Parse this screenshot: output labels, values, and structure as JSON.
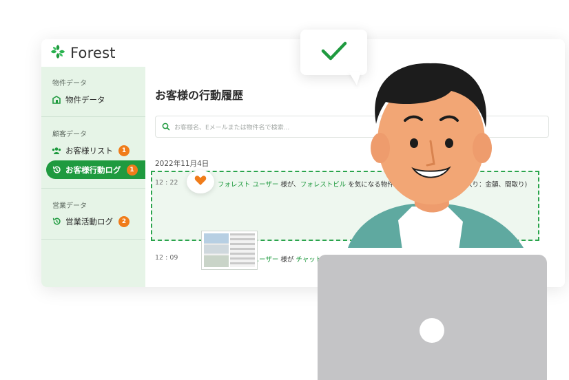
{
  "app": {
    "name": "Forest"
  },
  "sidebar": {
    "groups": [
      {
        "title": "物件データ",
        "items": [
          {
            "label": "物件データ",
            "icon": "building-icon",
            "badge": ""
          }
        ]
      },
      {
        "title": "顧客データ",
        "items": [
          {
            "label": "お客様リスト",
            "icon": "users-icon",
            "badge": "1"
          },
          {
            "label": "お客様行動ログ",
            "icon": "history-icon",
            "badge": "1",
            "active": true
          }
        ]
      },
      {
        "title": "営業データ",
        "items": [
          {
            "label": "営業活動ログ",
            "icon": "history-icon",
            "badge": "2"
          }
        ]
      }
    ]
  },
  "main": {
    "title": "お客様の行動履歴",
    "search": {
      "placeholder": "お客様名、Eメールまたは物件名で検索..."
    },
    "date": "2022年11月4日",
    "entries": [
      {
        "time": "12 : 22",
        "icon": "heart-icon",
        "user": "フォレスト ユーザー",
        "text_a": " 様が、",
        "property": "フォレストビル",
        "text_b": " を気になる物件に",
        "text_c": "気に入り：金額、間取り)"
      },
      {
        "time": "12 : 09",
        "icon": "chat-icon",
        "user": "フォレスト ユーザー",
        "text_a": " 様が ",
        "link": "チャット"
      }
    ]
  },
  "colors": {
    "brand_green": "#1f9a3f",
    "badge_orange": "#f07c1a",
    "sidebar_bg": "#e6f4e7"
  }
}
